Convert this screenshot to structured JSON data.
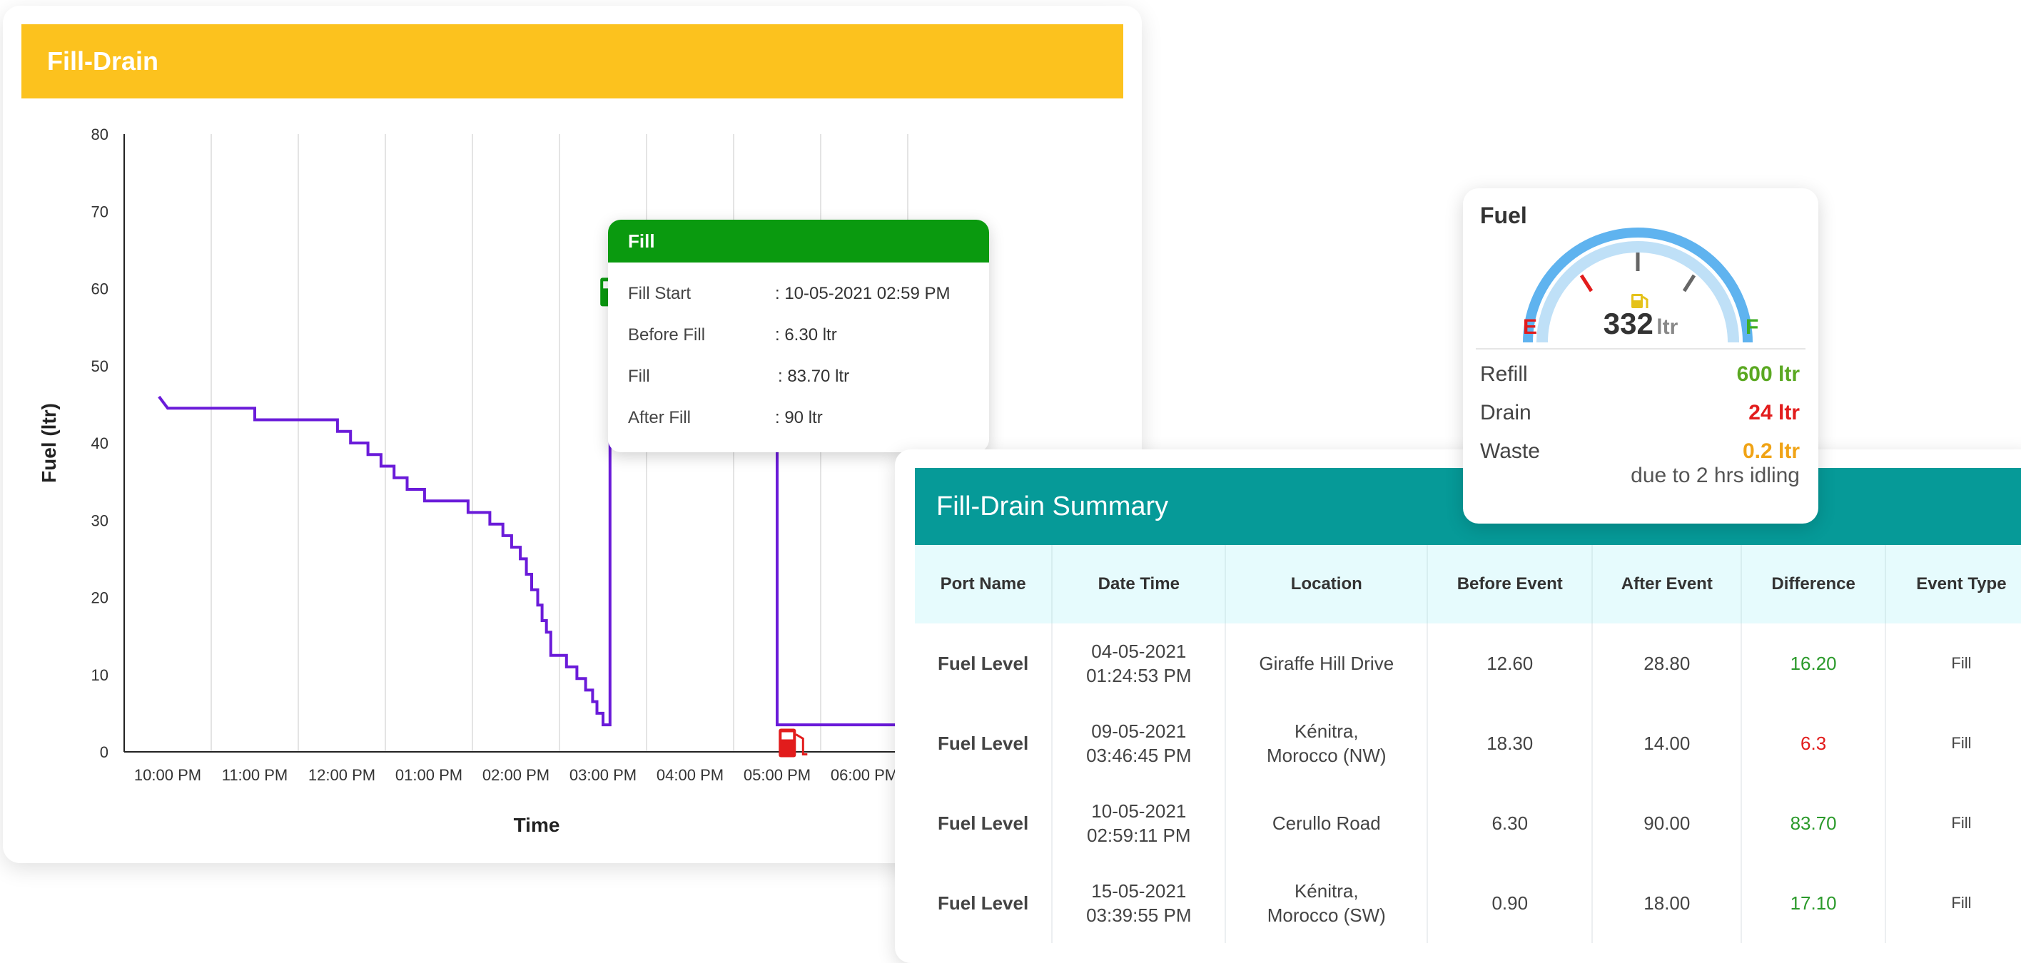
{
  "panel": {
    "title": "Fill-Drain"
  },
  "chart_data": {
    "type": "line",
    "ylabel": "Fuel (ltr)",
    "xlabel": "Time",
    "ylim": [
      0,
      80
    ],
    "yticks": [
      0,
      10,
      20,
      30,
      40,
      50,
      60,
      70,
      80
    ],
    "xticks": [
      "10:00 PM",
      "11:00 PM",
      "12:00 PM",
      "01:00 PM",
      "02:00 PM",
      "03:00 PM",
      "04:00 PM",
      "05:00 PM",
      "06:00 PM"
    ],
    "grid": true,
    "series": [
      {
        "color": "#6a1bd9",
        "points": [
          [
            -0.1,
            46.0
          ],
          [
            0.0,
            44.5
          ],
          [
            1.0,
            44.5
          ],
          [
            1.0,
            43.0
          ],
          [
            1.95,
            43.0
          ],
          [
            1.95,
            41.5
          ],
          [
            2.1,
            41.5
          ],
          [
            2.1,
            40.0
          ],
          [
            2.3,
            40.0
          ],
          [
            2.3,
            38.5
          ],
          [
            2.45,
            38.5
          ],
          [
            2.45,
            37.0
          ],
          [
            2.6,
            37.0
          ],
          [
            2.6,
            35.5
          ],
          [
            2.75,
            35.5
          ],
          [
            2.75,
            34.0
          ],
          [
            2.95,
            34.0
          ],
          [
            2.95,
            32.5
          ],
          [
            3.45,
            32.5
          ],
          [
            3.45,
            31.0
          ],
          [
            3.7,
            31.0
          ],
          [
            3.7,
            29.5
          ],
          [
            3.85,
            29.5
          ],
          [
            3.85,
            28.0
          ],
          [
            3.95,
            28.0
          ],
          [
            3.95,
            26.5
          ],
          [
            4.05,
            26.5
          ],
          [
            4.05,
            25.0
          ],
          [
            4.12,
            25.0
          ],
          [
            4.12,
            23.0
          ],
          [
            4.18,
            23.0
          ],
          [
            4.18,
            21.0
          ],
          [
            4.25,
            21.0
          ],
          [
            4.25,
            19.0
          ],
          [
            4.3,
            19.0
          ],
          [
            4.3,
            17.0
          ],
          [
            4.35,
            17.0
          ],
          [
            4.35,
            15.5
          ],
          [
            4.4,
            15.5
          ],
          [
            4.4,
            12.5
          ],
          [
            4.58,
            12.5
          ],
          [
            4.58,
            11.0
          ],
          [
            4.7,
            11.0
          ],
          [
            4.7,
            9.5
          ],
          [
            4.8,
            9.5
          ],
          [
            4.8,
            8.0
          ],
          [
            4.88,
            8.0
          ],
          [
            4.88,
            6.5
          ],
          [
            4.93,
            6.5
          ],
          [
            4.93,
            5.0
          ],
          [
            5.0,
            5.0
          ],
          [
            5.0,
            3.5
          ],
          [
            5.08,
            3.5
          ],
          [
            5.08,
            56.5
          ],
          [
            5.25,
            56.5
          ],
          [
            5.25,
            55.0
          ],
          [
            5.35,
            55.0
          ],
          [
            5.35,
            53.5
          ],
          [
            5.55,
            53.5
          ],
          [
            5.55,
            52.0
          ],
          [
            7.0,
            52.0
          ],
          [
            7.0,
            3.5
          ],
          [
            9.3,
            3.5
          ]
        ]
      }
    ],
    "markers": [
      {
        "x": 5.1,
        "y": 59.0,
        "kind": "fill",
        "color": "#0a9a0f",
        "icon": "fuel-pump-icon"
      },
      {
        "x": 7.15,
        "y": 0.6,
        "kind": "drain",
        "color": "#e21c1c",
        "icon": "fuel-pump-icon"
      }
    ]
  },
  "tooltip": {
    "title": "Fill",
    "rows": [
      {
        "label": "Fill Start",
        "value": ": 10-05-2021 02:59 PM"
      },
      {
        "label": "Before Fill",
        "value": ": 6.30 ltr"
      },
      {
        "label": "Fill",
        "value": ": 83.70 ltr"
      },
      {
        "label": "After Fill",
        "value": ": 90 ltr"
      }
    ]
  },
  "gauge": {
    "title": "Fuel",
    "value": "332",
    "unit": "ltr",
    "empty_label": "E",
    "full_label": "F",
    "colors": {
      "arc": "#5fb3ef",
      "arc_light": "#bfe0f7",
      "empty": "#e21c1c",
      "full": "#3fae25",
      "pump": "#e5c21a"
    },
    "rows": [
      {
        "label": "Refill",
        "value": "600 ltr",
        "color": "#5aa821"
      },
      {
        "label": "Drain",
        "value": "24 ltr",
        "color": "#e21c1c"
      },
      {
        "label": "Waste",
        "value": "0.2 ltr",
        "color": "#f0a315"
      }
    ],
    "note": "due to 2 hrs idling"
  },
  "summary": {
    "title": "Fill-Drain Summary",
    "columns": [
      "Port Name",
      "Date Time",
      "Location",
      "Before Event",
      "After Event",
      "Difference",
      "Event Type"
    ],
    "rows": [
      {
        "port": "Fuel Level",
        "date": "04-05-2021",
        "time": "01:24:53 PM",
        "loc1": "Giraffe Hill Drive",
        "loc2": "",
        "before": "12.60",
        "after": "28.80",
        "diff": "16.20",
        "diff_color": "#2b9a2b",
        "type": "Fill"
      },
      {
        "port": "Fuel Level",
        "date": "09-05-2021",
        "time": "03:46:45 PM",
        "loc1": "Kénitra,",
        "loc2": "Morocco (NW)",
        "before": "18.30",
        "after": "14.00",
        "diff": "6.3",
        "diff_color": "#e21c1c",
        "type": "Fill"
      },
      {
        "port": "Fuel Level",
        "date": "10-05-2021",
        "time": "02:59:11 PM",
        "loc1": "Cerullo Road",
        "loc2": "",
        "before": "6.30",
        "after": "90.00",
        "diff": "83.70",
        "diff_color": "#2b9a2b",
        "type": "Fill"
      },
      {
        "port": "Fuel Level",
        "date": "15-05-2021",
        "time": "03:39:55 PM",
        "loc1": "Kénitra,",
        "loc2": "Morocco (SW)",
        "before": "0.90",
        "after": "18.00",
        "diff": "17.10",
        "diff_color": "#2b9a2b",
        "type": "Fill"
      }
    ]
  }
}
